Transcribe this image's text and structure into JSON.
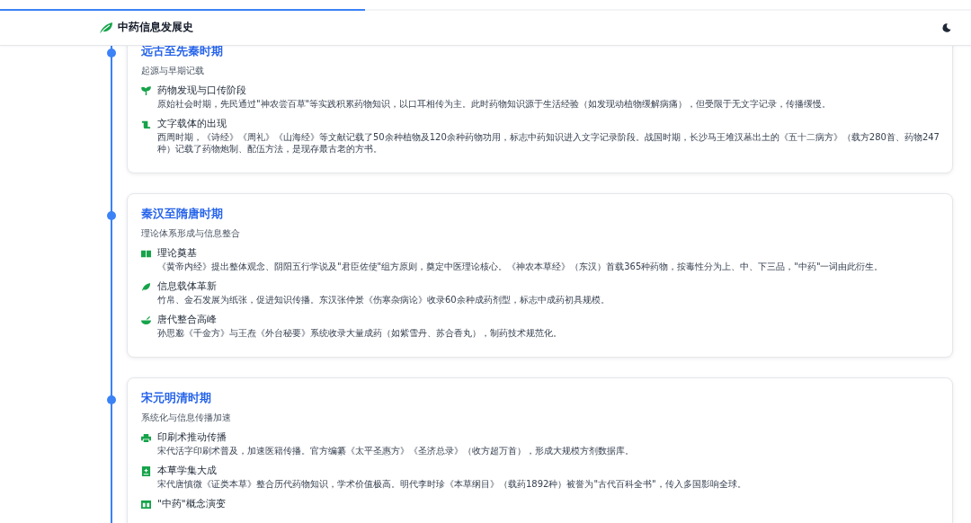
{
  "header": {
    "title": "中药信息发展史",
    "progress": {
      "level": 0.376
    }
  },
  "periods": [
    {
      "title": "远古至先秦时期",
      "subtitle": "起源与早期记载",
      "items": [
        {
          "title": "药物发现与口传阶段",
          "text": "原始社会时期，先民通过\"神农尝百草\"等实践积累药物知识，以口耳相传为主。此时药物知识源于生活经验（如发现动植物缓解病痛），但受限于无文字记录，传播缓慢。"
        },
        {
          "title": "文字载体的出现",
          "text": "西周时期，《诗经》《周礼》《山海经》等文献记载了50余种植物及120余种药物功用，标志中药知识进入文字记录阶段。战国时期，长沙马王堆汉墓出土的《五十二病方》（载方280首、药物247种）记载了药物炮制、配伍方法，是现存最古老的方书。"
        }
      ]
    },
    {
      "title": "秦汉至隋唐时期",
      "subtitle": "理论体系形成与信息整合",
      "items": [
        {
          "title": "理论奠基",
          "text": "《黄帝内经》提出整体观念、阴阳五行学说及\"君臣佐使\"组方原则，奠定中医理论核心。《神农本草经》（东汉）首载365种药物，按毒性分为上、中、下三品，\"中药\"一词由此衍生。"
        },
        {
          "title": "信息载体革新",
          "text": "竹帛、金石发展为纸张，促进知识传播。东汉张仲景《伤寒杂病论》收录60余种成药剂型，标志中成药初具规模。"
        },
        {
          "title": "唐代整合高峰",
          "text": "孙思邈《千金方》与王焘《外台秘要》系统收录大量成药（如紫雪丹、苏合香丸），制药技术规范化。"
        }
      ]
    },
    {
      "title": "宋元明清时期",
      "subtitle": "系统化与信息传播加速",
      "items": [
        {
          "title": "印刷术推动传播",
          "text": "宋代活字印刷术普及，加速医籍传播。官方编纂《太平圣惠方》《圣济总录》（收方超万首），形成大规模方剂数据库。"
        },
        {
          "title": "本草学集大成",
          "text": "宋代唐慎微《证类本草》整合历代药物知识，学术价值极高。明代李时珍《本草纲目》（载药1892种）被誉为\"古代百科全书\"，传入多国影响全球。"
        },
        {
          "title": "\"中药\"概念演变"
        }
      ]
    }
  ]
}
